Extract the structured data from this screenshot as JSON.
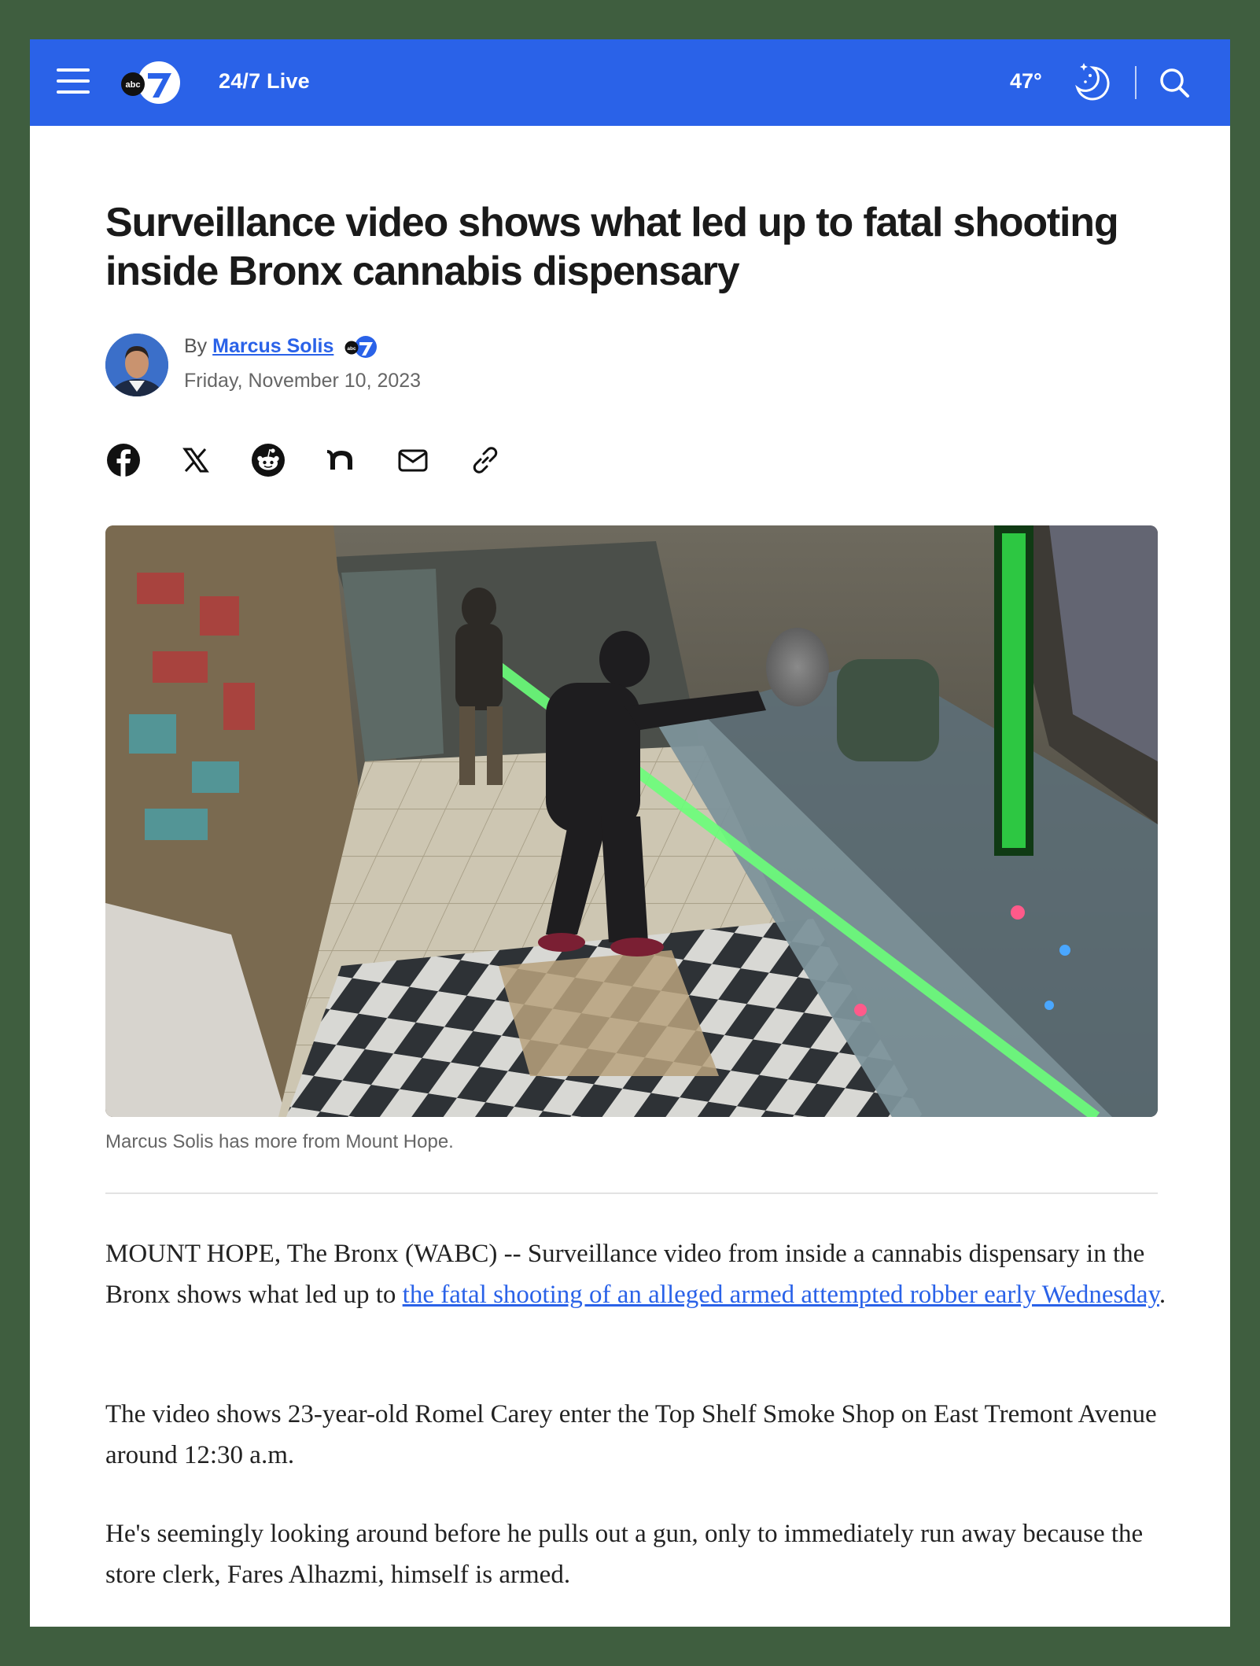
{
  "header": {
    "live_label": "24/7 Live",
    "temperature": "47°",
    "weather_icon": "moon-stars-icon",
    "brand_color": "#2a62e8"
  },
  "article": {
    "headline": "Surveillance video shows what led up to fatal shooting inside Bronx cannabis dispensary",
    "byline_prefix": "By",
    "author": "Marcus Solis",
    "date": "Friday, November 10, 2023",
    "share_icons": [
      "facebook-icon",
      "x-icon",
      "reddit-icon",
      "nextdoor-icon",
      "email-icon",
      "link-icon"
    ],
    "caption": "Marcus Solis has more from Mount Hope.",
    "paragraphs": [
      {
        "before": "MOUNT HOPE, The Bronx (WABC) -- Surveillance video from inside a cannabis dispensary in the Bronx shows what led up to ",
        "link": "the fatal shooting of an alleged armed attempted robber early Wednesday",
        "after": "."
      },
      {
        "text": "The video shows 23-year-old Romel Carey enter the Top Shelf Smoke Shop on East Tremont Avenue around 12:30 a.m."
      },
      {
        "text": "He's seemingly looking around before he pulls out a gun, only to immediately run away because the store clerk, Fares Alhazmi, himself is armed."
      }
    ]
  }
}
